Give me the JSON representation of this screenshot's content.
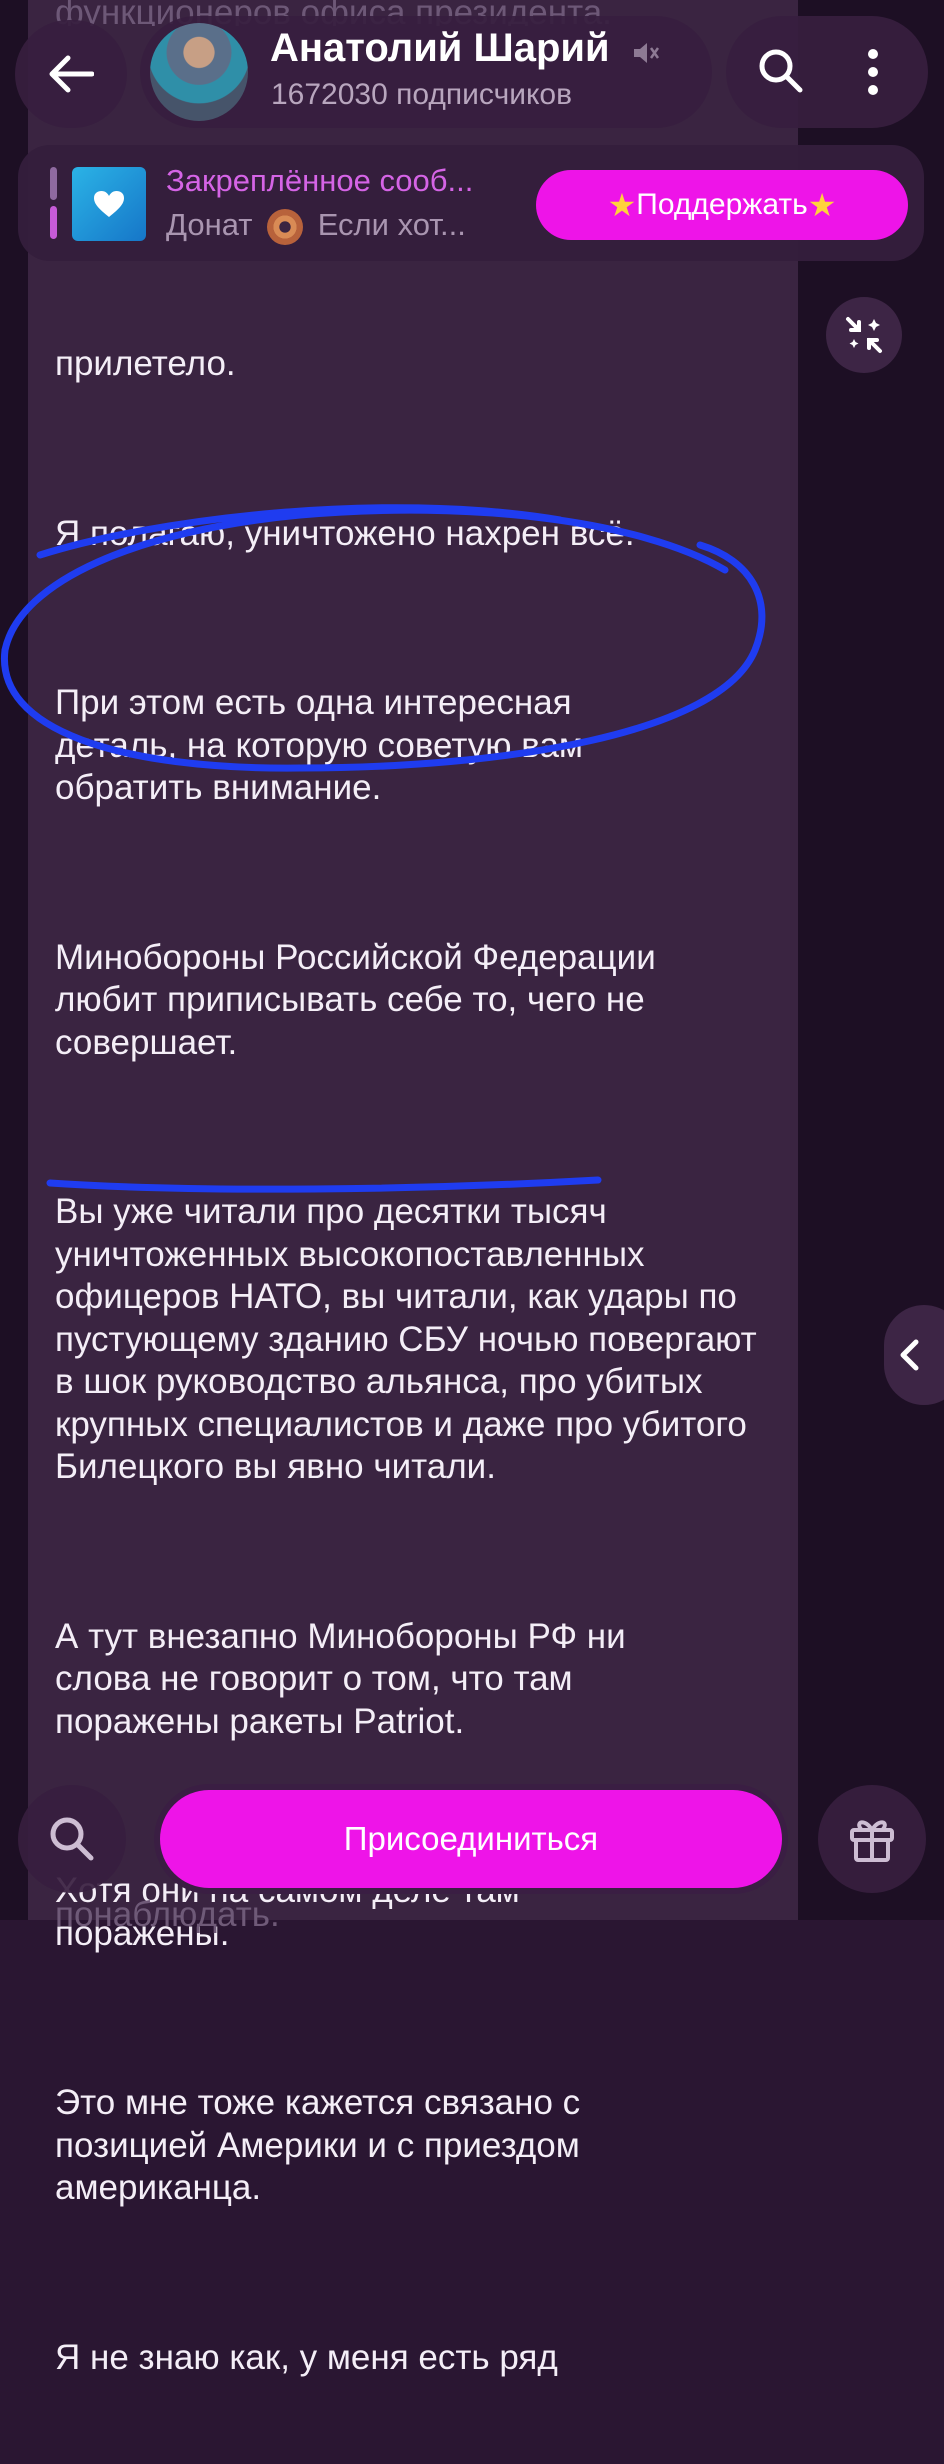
{
  "header": {
    "back_icon": "arrow-left-icon",
    "channel_name": "Анатолий Шарий",
    "mute_icon": "muted-speaker-icon",
    "subscribers": "1672030 подписчиков",
    "search_icon": "search-icon",
    "menu_icon": "more-vertical-icon"
  },
  "pinned": {
    "title": "Закреплённое сооб...",
    "body_prefix": "Донат",
    "body_suffix": "Если хот...",
    "thumb_icon": "heart-icon",
    "support_button": "Поддержать",
    "star_icon": "★"
  },
  "message": {
    "top_partial": "функционеров офиса президента.",
    "paragraphs": [
      "прилетело.",
      "Я полагаю, уничтожено нахрен всё.",
      "При этом есть одна интересная деталь, на которую советую вам обратить внимание.",
      "Минобороны Российской Федерации любит приписывать себе то, чего не совершает.",
      "Вы уже читали про десятки тысяч уничтоженных высокопоставленных офицеров НАТО, вы читали, как удары по пустующему зданию СБУ ночью повергают в шок руководство альянса, про убитых крупных специалистов и даже про убитого Билецкого вы явно читали.",
      "А тут внезапно Минобороны РФ ни слова не говорит о том, что там поражены ракеты Patriot.",
      "Хотя они на самом деле там поражены.",
      "Это мне тоже кажется связано с позицией Америки и с приездом американца.",
      "Я не знаю как, у меня есть ряд"
    ],
    "bottom_partial": "понаблюдать."
  },
  "controls": {
    "collapse_icon": "collapse-icon",
    "side_arrow_icon": "chevron-left-icon"
  },
  "bottom": {
    "search_icon": "search-icon",
    "join_button": "Присоединиться",
    "gift_icon": "gift-icon"
  },
  "colors": {
    "accent": "#ee14e8",
    "background": "#2a1632",
    "bubble": "#3a2441",
    "annotation": "#1f3cf0"
  }
}
